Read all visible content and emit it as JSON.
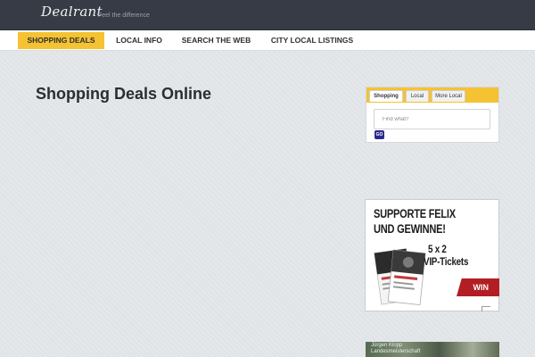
{
  "header": {
    "logo_text": "Dealrant",
    "tagline": "Feel the difference"
  },
  "nav": {
    "items": [
      {
        "label": "Shopping Deals",
        "active": true
      },
      {
        "label": "Local Info",
        "active": false
      },
      {
        "label": "Search the Web",
        "active": false
      },
      {
        "label": "City Local Listings",
        "active": false
      }
    ]
  },
  "main": {
    "page_title": "Shopping Deals Online"
  },
  "search_widget": {
    "tabs": [
      {
        "label": "Shopping",
        "active": true
      },
      {
        "label": "Local",
        "active": false
      },
      {
        "label": "More Local",
        "active": false
      }
    ],
    "placeholder": "Find what?",
    "go_label": "GO"
  },
  "ad": {
    "line1": "SUPPORTE FELIX",
    "line2": "UND GEWINNE!",
    "line3": "5 x 2",
    "line4": "VIP-Tickets",
    "cta": "WIN"
  },
  "photo_ad": {
    "caption": "Jürgen Klopp Landesmeisterschaft"
  },
  "colors": {
    "accent": "#f4c233",
    "topbar": "#363b45",
    "background": "#e3e7ea",
    "go_button": "#2b2a8c",
    "ad_red": "#b21e23"
  }
}
